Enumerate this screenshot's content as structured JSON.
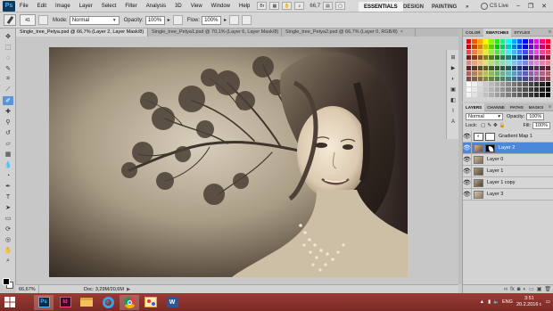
{
  "app": {
    "logo_text": "Ps",
    "menu": [
      "File",
      "Edit",
      "Image",
      "Layer",
      "Select",
      "Filter",
      "Analysis",
      "3D",
      "View",
      "Window",
      "Help"
    ],
    "zoom_readout": "66,7",
    "workspaces": [
      "ESSENTIALS",
      "DESIGN",
      "PAINTING",
      "»"
    ],
    "cs_live": "CS Live",
    "window_controls": [
      "–",
      "❐",
      "✕"
    ]
  },
  "options_bar": {
    "brush_size": "41",
    "mode_label": "Mode:",
    "mode_value": "Normal",
    "opacity_label": "Opacity:",
    "opacity_value": "100%",
    "flow_label": "Flow:",
    "flow_value": "100%"
  },
  "tabs": [
    {
      "label": "Single_tree_Petya.psd @ 66,7% (Layer 2, Layer Mask/8)",
      "active": true
    },
    {
      "label": "Single_tree_Petya1.psd @ 70,1% (Layer 6, Layer Mask/8)",
      "active": false
    },
    {
      "label": "Single_tree_Petya2.psd @ 66,7% (Layer 0, RGB/8)",
      "active": false
    }
  ],
  "status": {
    "zoom": "66,67%",
    "doc": "Doc: 3,29M/20,6M"
  },
  "swatches_panel": {
    "tabs": [
      "COLOR",
      "SWATCHES",
      "STYLES"
    ]
  },
  "layers_panel": {
    "tabs": [
      "LAYERS",
      "CHANNE",
      "PATHS",
      "MASKS"
    ],
    "blend_mode": "Normal",
    "opacity_label": "Opacity:",
    "opacity_value": "100%",
    "lock_label": "Lock:",
    "fill_label": "Fill:",
    "fill_value": "100%",
    "layers": [
      {
        "name": "Gradient Map 1",
        "selected": false
      },
      {
        "name": "Layer 2",
        "selected": true
      },
      {
        "name": "Layer 0",
        "selected": false
      },
      {
        "name": "Layer 1",
        "selected": false
      },
      {
        "name": "Layer 1 copy",
        "selected": false
      },
      {
        "name": "Layer 3",
        "selected": false
      }
    ]
  },
  "taskbar": {
    "apps": [
      "photoshop-icon",
      "indesign-icon",
      "file-explorer-icon",
      "internet-explorer-icon",
      "chrome-icon",
      "paint-icon",
      "word-icon"
    ],
    "language": "ENG",
    "time": "3:51",
    "date": "20.2.2016 г."
  }
}
